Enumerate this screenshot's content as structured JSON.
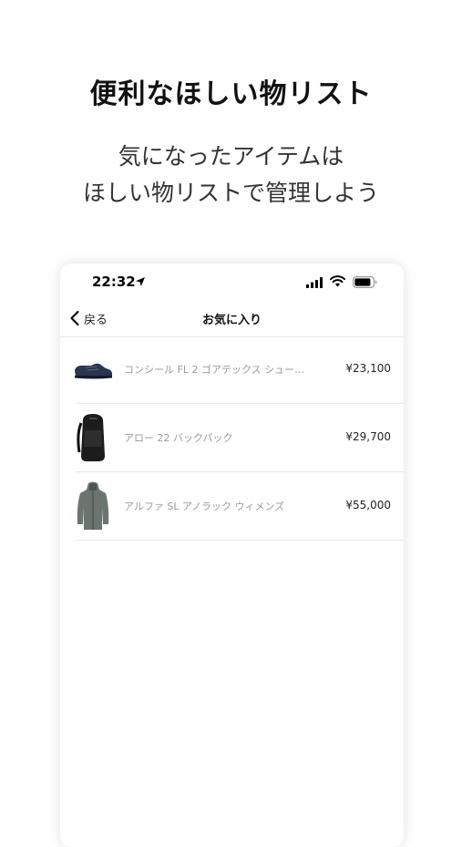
{
  "promo": {
    "title": "便利なほしい物リスト",
    "subtitle_line1": "気になったアイテムは",
    "subtitle_line2": "ほしい物リストで管理しよう"
  },
  "status_bar": {
    "time": "22:32",
    "icons": [
      "location-arrow-icon",
      "signal-bars-icon",
      "wifi-icon",
      "battery-icon"
    ]
  },
  "nav": {
    "back_label": "戻る",
    "title": "お気に入り"
  },
  "favorites": [
    {
      "name": "コンシール FL 2 ゴアテックス シュー…",
      "price": "¥23,100",
      "icon": "hiking-shoe-icon"
    },
    {
      "name": "アロー 22 バックパック",
      "price": "¥29,700",
      "icon": "backpack-icon"
    },
    {
      "name": "アルファ SL アノラック ウィメンズ",
      "price": "¥55,000",
      "icon": "anorak-jacket-icon"
    }
  ],
  "colors": {
    "shoe": "#2a3550",
    "backpack": "#1c1c1c",
    "jacket": "#6b7570"
  }
}
